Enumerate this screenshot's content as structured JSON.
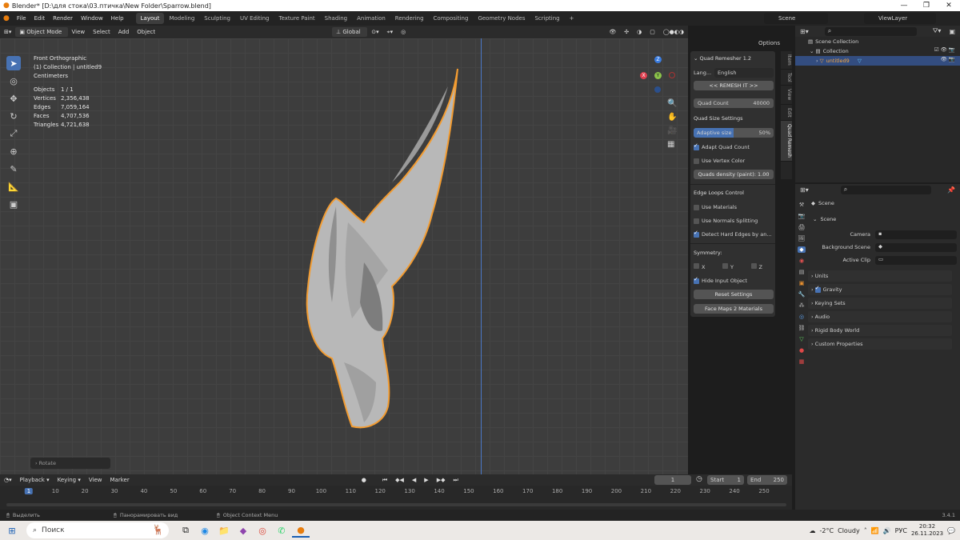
{
  "window": {
    "title": "Blender* [D:\\для стока\\03.птичка\\New Folder\\Sparrow.blend]"
  },
  "menu": [
    "File",
    "Edit",
    "Render",
    "Window",
    "Help"
  ],
  "workspaces": [
    "Layout",
    "Modeling",
    "Sculpting",
    "UV Editing",
    "Texture Paint",
    "Shading",
    "Animation",
    "Rendering",
    "Compositing",
    "Geometry Nodes",
    "Scripting"
  ],
  "scene_field": "Scene",
  "viewlayer_field": "ViewLayer",
  "viewport_header": {
    "mode": "Object Mode",
    "view": "View",
    "select": "Select",
    "add": "Add",
    "object": "Object",
    "orientation": "Global",
    "options": "Options"
  },
  "viewport_info": {
    "view_name": "Front Orthographic",
    "collection": "(1) Collection | untitled9",
    "units": "Centimeters",
    "stats": [
      {
        "label": "Objects",
        "value": "1 / 1"
      },
      {
        "label": "Vertices",
        "value": "2,356,438"
      },
      {
        "label": "Edges",
        "value": "7,059,164"
      },
      {
        "label": "Faces",
        "value": "4,707,536"
      },
      {
        "label": "Triangles",
        "value": "4,721,638"
      }
    ]
  },
  "gizmo": {
    "x": "X",
    "y": "Y",
    "z": "Z"
  },
  "last_op": "Rotate",
  "npanel": {
    "title": "Quad Remesher 1.2",
    "lang_label": "Lang...",
    "lang_value": "English",
    "remesh_button": "<< REMESH IT >>",
    "quad_count_label": "Quad Count",
    "quad_count_value": "40000",
    "quad_size_title": "Quad Size Settings",
    "adaptive_label": "Adaptive size",
    "adaptive_value": "50%",
    "adaptive_fraction": 0.5,
    "adapt_quad_count": "Adapt Quad Count",
    "use_vertex_color": "Use Vertex Color",
    "quads_density": "Quads density (paint): 1.00",
    "edge_loops_title": "Edge Loops Control",
    "use_materials": "Use Materials",
    "use_normals": "Use Normals Splitting",
    "detect_hard": "Detect Hard Edges by an...",
    "symmetry_title": "Symmetry:",
    "sym_x": "X",
    "sym_y": "Y",
    "sym_z": "Z",
    "hide_input": "Hide Input Object",
    "reset_settings": "Reset Settings",
    "face_maps": "Face Maps 2 Materials"
  },
  "side_tabs": [
    "Item",
    "Tool",
    "View",
    "Edit",
    "Quad Remesh"
  ],
  "outliner": {
    "root": "Scene Collection",
    "collection": "Collection",
    "object": "untitled9"
  },
  "properties": {
    "header": "Scene",
    "section": "Scene",
    "camera_label": "Camera",
    "bg_scene_label": "Background Scene",
    "active_clip_label": "Active Clip",
    "panels": [
      "Units",
      "Gravity",
      "Keying Sets",
      "Audio",
      "Rigid Body World",
      "Custom Properties"
    ]
  },
  "timeline": {
    "playback": "Playback",
    "keying": "Keying",
    "view": "View",
    "marker": "Marker",
    "current_frame": "1",
    "start_label": "Start",
    "start_value": "1",
    "end_label": "End",
    "end_value": "250",
    "ticks": [
      "1",
      "10",
      "20",
      "30",
      "40",
      "50",
      "60",
      "70",
      "80",
      "90",
      "100",
      "110",
      "120",
      "130",
      "140",
      "150",
      "160",
      "170",
      "180",
      "190",
      "200",
      "210",
      "220",
      "230",
      "240",
      "250"
    ]
  },
  "statusbar": {
    "select": "Выделить",
    "pan": "Панорамировать вид",
    "context": "Object Context Menu",
    "version": "3.4.1"
  },
  "taskbar": {
    "search": "Поиск",
    "weather_temp": "-2°C",
    "weather_desc": "Cloudy",
    "lang": "РУС",
    "time": "20:32",
    "date": "26.11.2023"
  },
  "colors": {
    "accent": "#4772b3",
    "selection": "#f39c31",
    "x_axis": "#e04050",
    "y_axis": "#8bc34a",
    "z_axis": "#3a7ce0"
  }
}
